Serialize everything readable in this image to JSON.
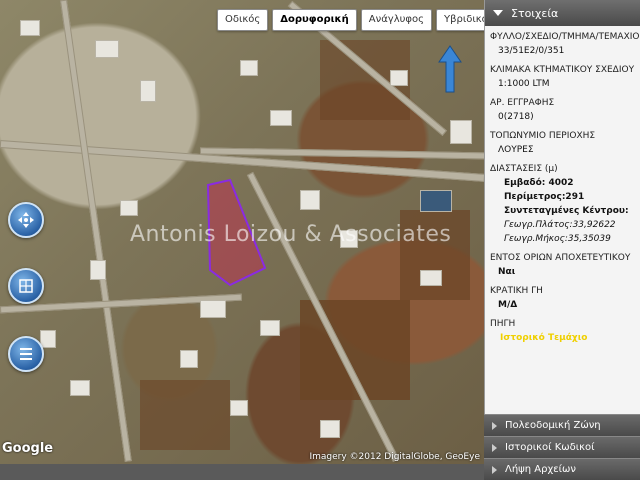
{
  "map": {
    "tabs": [
      {
        "label": "Οδικός",
        "active": false
      },
      {
        "label": "Δορυφορική",
        "active": true
      },
      {
        "label": "Ανάγλυφος",
        "active": false
      },
      {
        "label": "Υβριδικός",
        "active": false
      }
    ],
    "watermark": "Antonis Loizou & Associates",
    "google_logo": "Google",
    "attribution": "Imagery ©2012 DigitalGlobe, GeoEye",
    "parcel_color": "#8a2be2",
    "controls": [
      "pan-icon",
      "layers-icon",
      "list-icon"
    ]
  },
  "sidebar": {
    "header": "Στοιχεία",
    "fields": {
      "sheet_label": "ΦΥΛΛΟ/ΣΧΕΔΙΟ/ΤΜΗΜΑ/ΤΕΜΑΧΙΟ",
      "sheet_value": "33/51E2/0/351",
      "scale_label": "ΚΛΙΜΑΚΑ ΚΤΗΜΑΤΙΚΟΥ ΣΧΕΔΙΟΥ",
      "scale_value": "1:1000 LTM",
      "reg_label": "ΑΡ. ΕΓΓΡΑΦΗΣ",
      "reg_value": "0(2718)",
      "place_label": "ΤΟΠΩΝΥΜΙΟ ΠΕΡΙΟΧΗΣ",
      "place_value": "ΛΟΥΡΕΣ",
      "dims_label": "ΔΙΑΣΤΑΣΕΙΣ (μ)",
      "area": "Εμβαδό: 4002",
      "perimeter": "Περίμετρος:291",
      "center_label": "Συντεταγμένες Κέντρου:",
      "lat": "Γεωγρ.Πλάτος:33,92622",
      "lng": "Γεωγρ.Μήκος:35,35039",
      "sewage_label": "ΕΝΤΟΣ ΟΡΙΩΝ ΑΠΟΧΕΤΕΥΤΙΚΟΥ",
      "sewage_value": "Ναι",
      "state_label": "ΚΡΑΤΙΚΗ ΓΗ",
      "state_value": "Μ/Δ",
      "source_label": "ΠΗΓΗ",
      "source_value": "Ιστορικό Τεμάχιο"
    },
    "sections": [
      "Πολεοδομική Ζώνη",
      "Ιστορικοί Κωδικοί",
      "Λήψη Αρχείων"
    ]
  }
}
